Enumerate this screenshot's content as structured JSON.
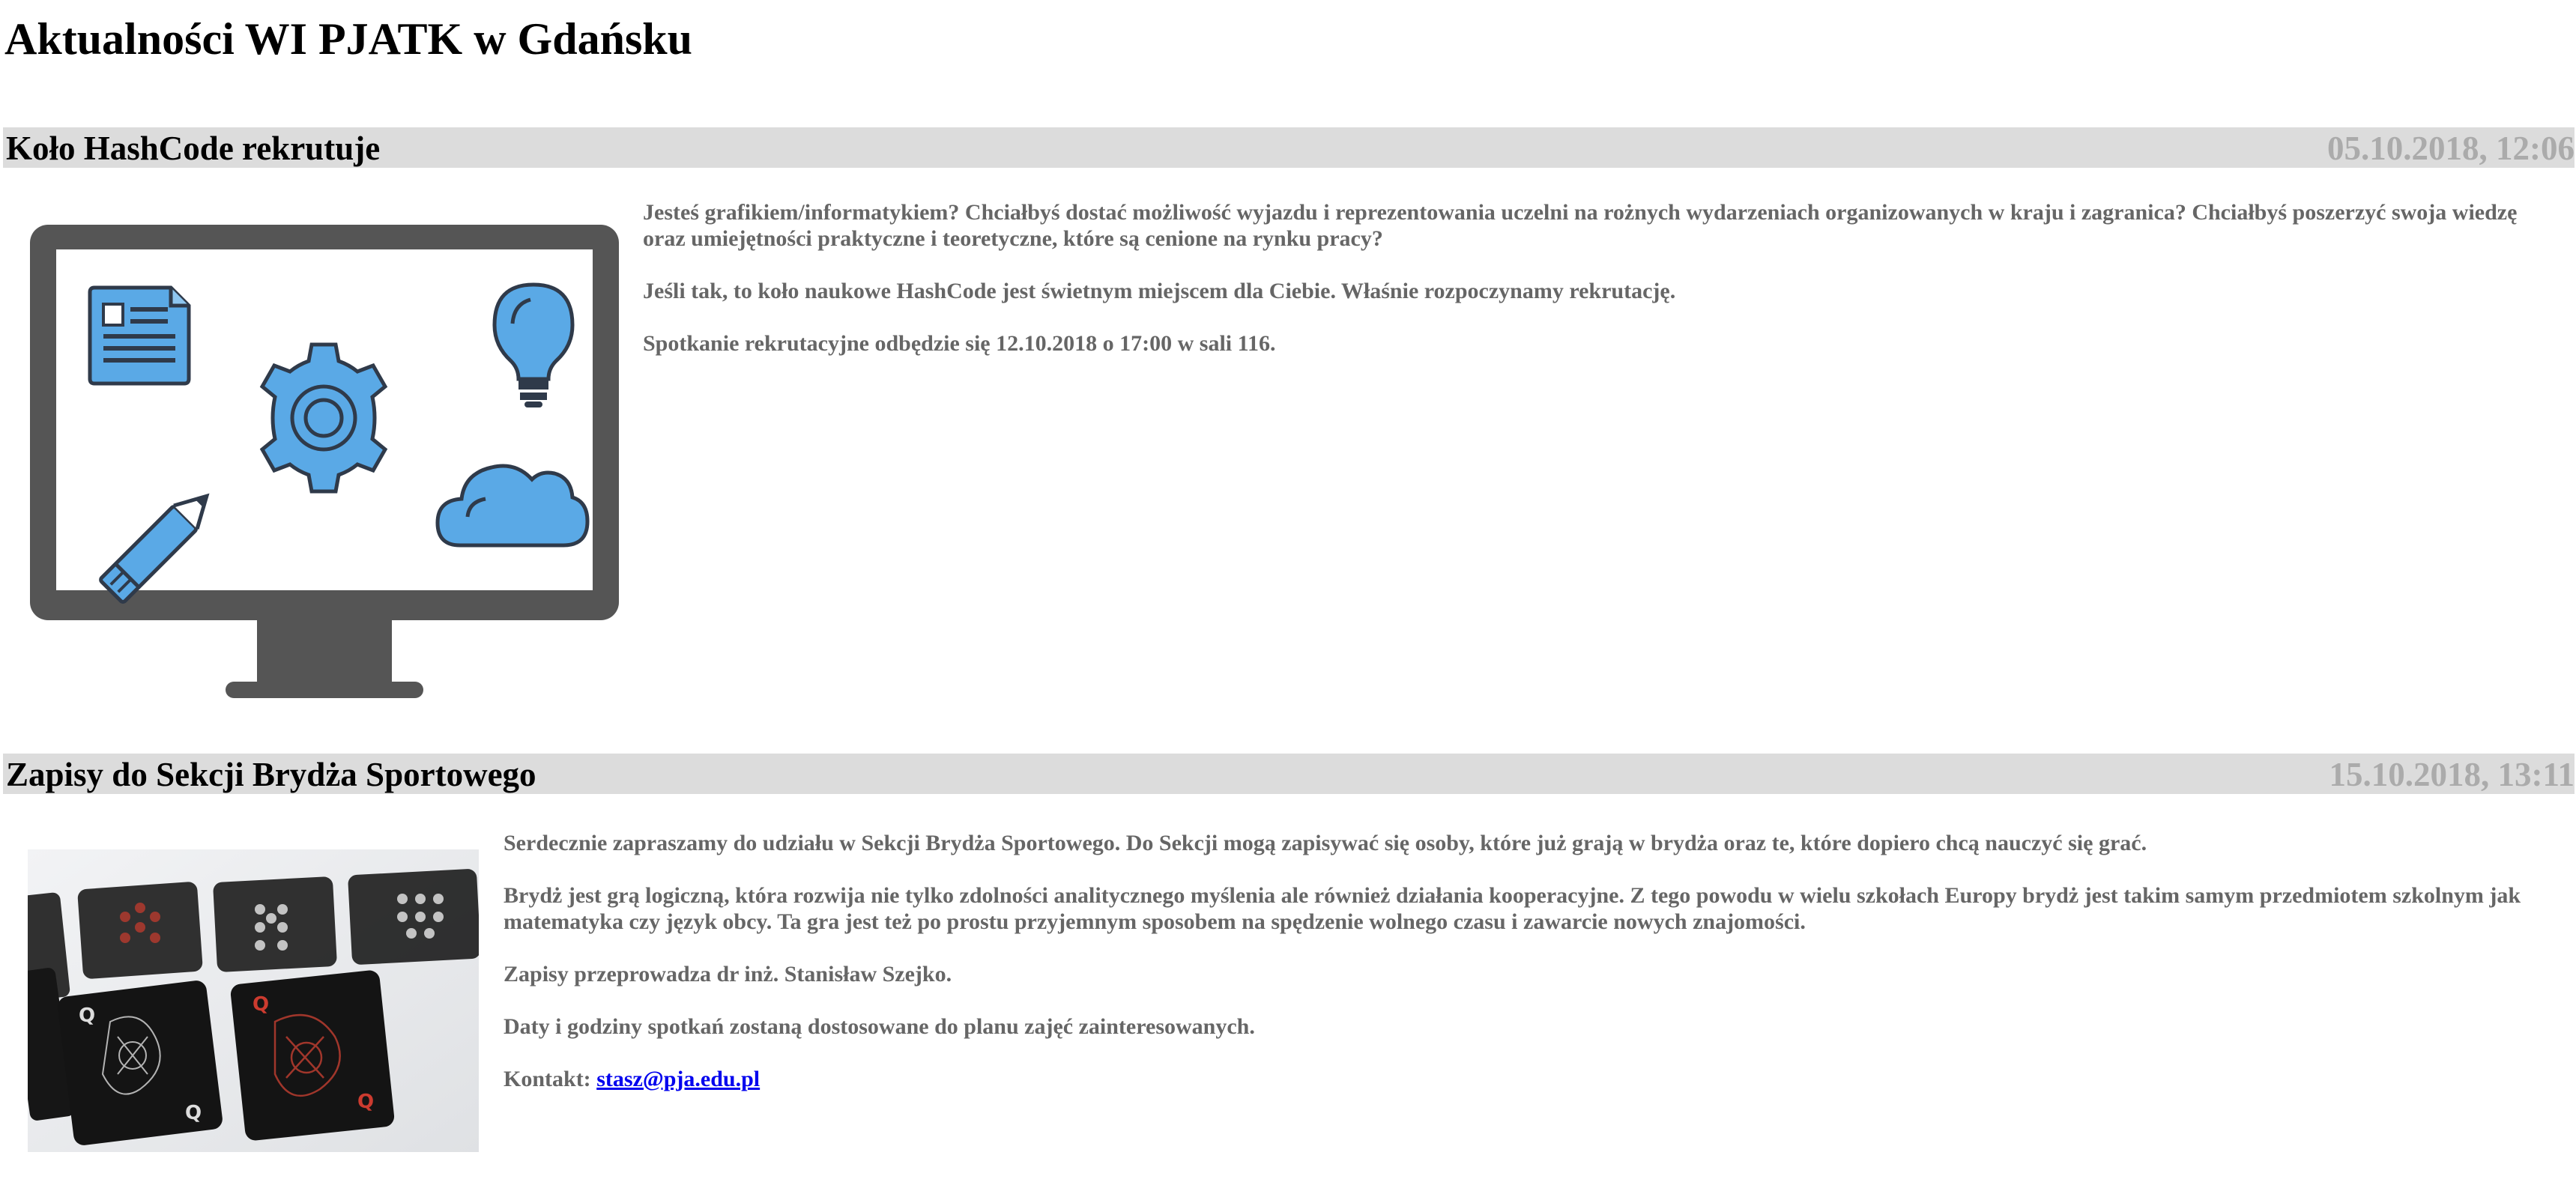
{
  "page": {
    "title": "Aktualności WI PJATK w Gdańsku"
  },
  "articles": [
    {
      "title": "Koło HashCode rekrutuje",
      "date": "05.10.2018, 12:06",
      "paragraphs": [
        "Jesteś grafikiem/informatykiem? Chciałbyś dostać możliwość wyjazdu i reprezentowania uczelni na rożnych wydarzeniach organizowanych w kraju i zagranica? Chciałbyś poszerzyć swoja wiedzę oraz umiejętności praktyczne i teoretyczne, które są cenione na rynku pracy?",
        "Jeśli tak, to koło naukowe HashCode jest świetnym miejscem dla Ciebie. Właśnie rozpoczynamy rekrutację.",
        "Spotkanie rekrutacyjne odbędzie się 12.10.2018 o 17:00 w sali 116."
      ]
    },
    {
      "title": "Zapisy do Sekcji Brydża Sportowego",
      "date": "15.10.2018, 13:11",
      "paragraphs": [
        "Serdecznie zapraszamy do udziału w Sekcji Brydża Sportowego. Do Sekcji mogą zapisywać się osoby, które już grają w brydża oraz te, które dopiero chcą nauczyć się grać.",
        "Brydż jest grą logiczną, która rozwija nie tylko zdolności analitycznego myślenia ale również działania kooperacyjne. Z tego powodu w wielu szkołach Europy brydż jest takim samym przedmiotem szkolnym jak matematyka czy język obcy. Ta gra jest też po prostu przyjemnym sposobem na spędzenie wolnego czasu i zawarcie nowych znajomości.",
        "Zapisy przeprowadza dr inż. Stanisław Szejko.",
        "Daty i godziny spotkań zostaną dostosowane do planu zajęć zainteresowanych."
      ],
      "contact_label": "Kontakt:",
      "contact_email": "stasz@pja.edu.pl"
    }
  ],
  "icons": {
    "monitor": "monitor-illustration-icon",
    "cards": "playing-cards-photo"
  },
  "colors": {
    "header_bg": "#dcdcdc",
    "date_text": "#ababab",
    "body_text": "#666666",
    "icon_blue": "#5aa9e6",
    "icon_dark": "#3f3f3f"
  }
}
